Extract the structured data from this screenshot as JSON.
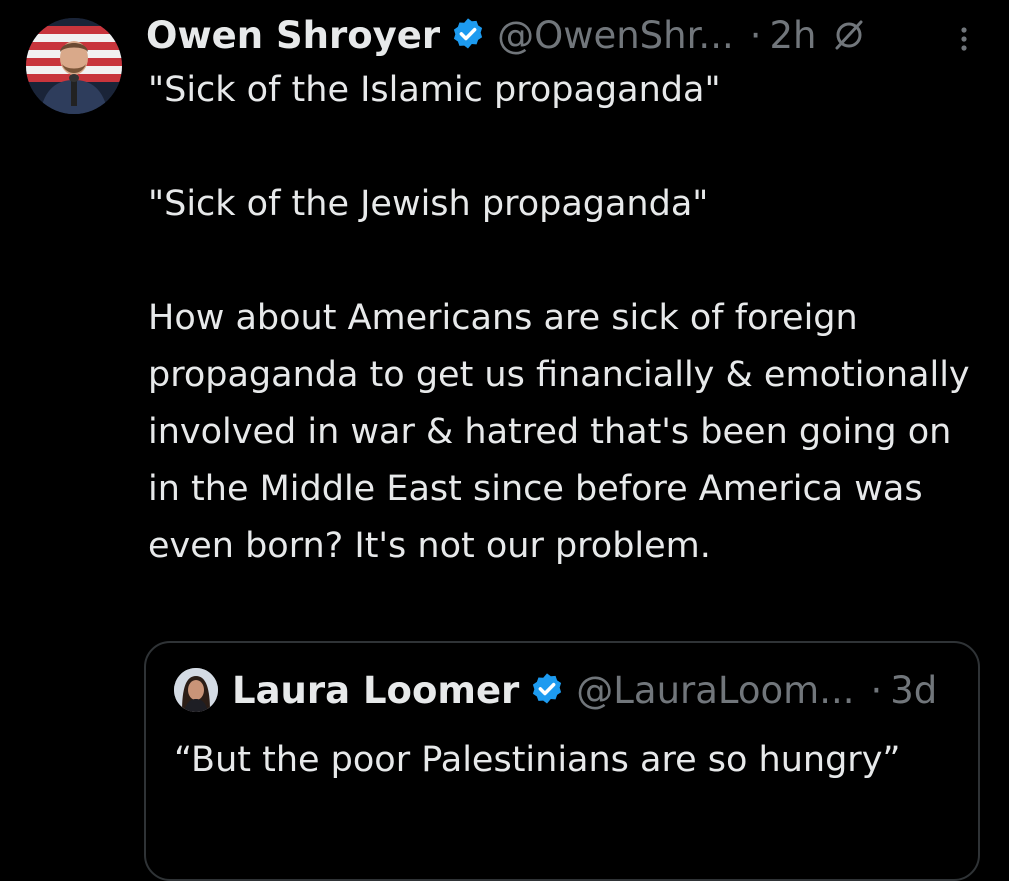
{
  "tweet": {
    "author_name": "Owen Shroyer",
    "author_handle": "@OwenShr...",
    "separator": "·",
    "time": "2h",
    "paragraphs": [
      "\"Sick of the Islamic propaganda\"",
      "\"Sick of the Jewish propaganda\"",
      "How about Americans are sick of foreign propaganda to get us financially & emotionally involved in war & hatred that's been going on in the Middle East since before America was even born? It's not our problem."
    ]
  },
  "quoted_tweet": {
    "author_name": "Laura Loomer",
    "author_handle": "@LauraLoom...",
    "separator": "·",
    "time": "3d",
    "text": "“But the poor Palestinians are so hungry”"
  },
  "icons": {
    "verified": "verified-badge-icon",
    "pinned": "pin-off-icon",
    "more": "more-vertical-icon"
  },
  "colors": {
    "background": "#000000",
    "primary_text": "#e7e9ea",
    "secondary_text": "#71767b",
    "verified": "#1d9bf0",
    "border": "#2f3336"
  }
}
